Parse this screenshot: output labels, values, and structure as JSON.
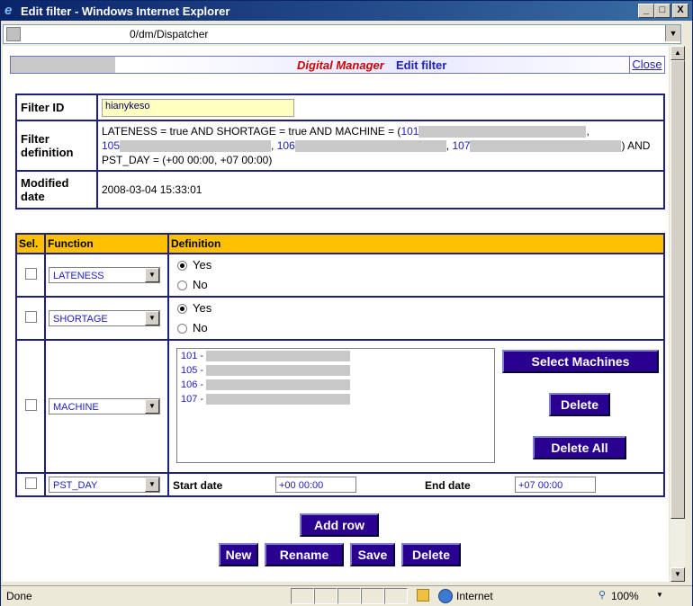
{
  "window": {
    "title": "Edit filter - Windows Internet Explorer",
    "minimize": "_",
    "maximize": "□",
    "close": "X"
  },
  "address": {
    "url": "0/dm/Dispatcher"
  },
  "header": {
    "app_name": "Digital Manager",
    "page_name": "Edit filter",
    "close_link": "Close"
  },
  "filter": {
    "id_label": "Filter ID",
    "id_value": "hianykeso",
    "definition_label_line1": "Filter",
    "definition_label_line2": "definition",
    "definition_part1": "LATENESS = true AND SHORTAGE = true AND MACHINE = (",
    "definition_m1": "101",
    "definition_m2": "105",
    "definition_m3": "106",
    "definition_m4": "107",
    "definition_comma": ",",
    "definition_tail": ") AND",
    "definition_line3": "PST_DAY = (+00 00:00, +07 00:00)",
    "modified_label_line1": "Modified",
    "modified_label_line2": "date",
    "modified_value": "2008-03-04 15:33:01"
  },
  "functions": {
    "col_sel": "Sel.",
    "col_function": "Function",
    "col_definition": "Definition",
    "rows": [
      {
        "function": "LATENESS",
        "yes": "Yes",
        "no": "No",
        "selected": "yes"
      },
      {
        "function": "SHORTAGE",
        "yes": "Yes",
        "no": "No",
        "selected": "yes"
      },
      {
        "function": "MACHINE"
      },
      {
        "function": "PST_DAY"
      }
    ],
    "machines": [
      "101 -",
      "105 -",
      "106 -",
      "107 -"
    ],
    "select_machines": "Select Machines",
    "delete": "Delete",
    "delete_all": "Delete All",
    "start_label": "Start date",
    "start_value": "+00 00:00",
    "end_label": "End date",
    "end_value": "+07 00:00"
  },
  "actions": {
    "add_row": "Add row",
    "new": "New",
    "rename": "Rename",
    "save": "Save",
    "delete": "Delete"
  },
  "status": {
    "text": "Done",
    "zone": "Internet",
    "zoom": "100%"
  }
}
